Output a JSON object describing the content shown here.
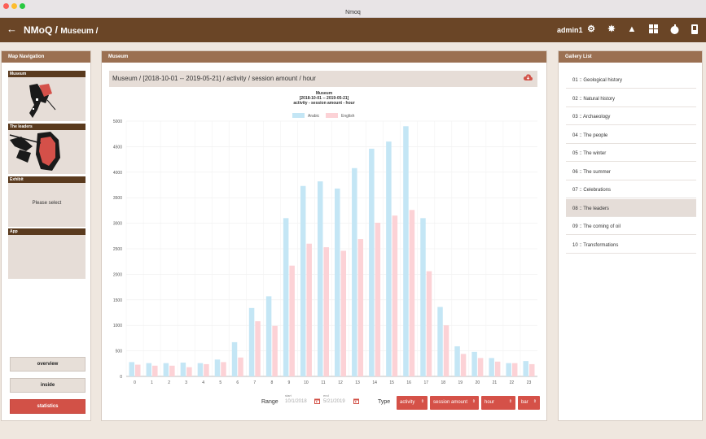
{
  "window": {
    "title": "Nmoq"
  },
  "appbar": {
    "title": "NMoQ / ",
    "subtitle": "Museum /",
    "user": "admin1",
    "back_icon": "arrow-left-icon"
  },
  "map_panel": {
    "header": "Map Navigation",
    "sections": [
      {
        "label": "Museum",
        "content": ""
      },
      {
        "label": "The leaders",
        "content": ""
      },
      {
        "label": "Exhibit",
        "content": "Please select"
      },
      {
        "label": "App",
        "content": ""
      }
    ],
    "buttons": [
      {
        "label": "overview",
        "active": false
      },
      {
        "label": "inside",
        "active": false
      },
      {
        "label": "statistics",
        "active": true
      }
    ]
  },
  "main_panel": {
    "header": "Museum",
    "chart_header": "Museum / [2018-10-01 -- 2019-05-21] / activity / session amount / hour",
    "controls": {
      "range_label": "Range",
      "start_label": "start",
      "end_label": "end",
      "start_value": "10/1/2018",
      "end_value": "5/21/2019",
      "type_label": "Type",
      "selects": [
        "activity",
        "session amount",
        "hour",
        "bar"
      ]
    }
  },
  "chart_data": {
    "type": "bar",
    "title": "Museum",
    "subtitle": "[2018-10-01 -- 2019-05-21]",
    "subtitle2": "activity - session amount - hour",
    "categories": [
      "0",
      "1",
      "2",
      "3",
      "4",
      "5",
      "6",
      "7",
      "8",
      "9",
      "10",
      "11",
      "12",
      "13",
      "14",
      "15",
      "16",
      "17",
      "18",
      "19",
      "20",
      "21",
      "22",
      "23"
    ],
    "series": [
      {
        "name": "Arabic",
        "color": "#c4e6f5",
        "values": [
          280,
          260,
          260,
          270,
          260,
          330,
          670,
          1340,
          1570,
          3100,
          3730,
          3820,
          3680,
          4080,
          4460,
          4600,
          4900,
          3100,
          1360,
          590,
          480,
          360,
          260,
          300
        ]
      },
      {
        "name": "English",
        "color": "#fcd2d6",
        "values": [
          230,
          210,
          210,
          180,
          240,
          280,
          370,
          1080,
          990,
          2170,
          2600,
          2530,
          2460,
          2690,
          3010,
          3150,
          3260,
          2060,
          1000,
          440,
          360,
          290,
          260,
          240
        ]
      }
    ],
    "yticks": [
      0,
      500,
      1000,
      1500,
      2000,
      2500,
      3000,
      3500,
      4000,
      4500,
      5000
    ],
    "ylim": [
      0,
      5000
    ],
    "legend": "top-center"
  },
  "gallery": {
    "header": "Gallery List",
    "items": [
      "01 :: Geological history",
      "02 :: Natural history",
      "03 :: Archaeology",
      "04 :: The people",
      "05 :: The winter",
      "06 :: The summer",
      "07 :: Celebrations",
      "08 :: The leaders",
      "09 :: The coming of oil",
      "10 :: Transformations"
    ],
    "selected_index": 7
  },
  "colors": {
    "brand": "#6a4526",
    "panel_header": "#9b7052",
    "accent": "#d55148"
  }
}
